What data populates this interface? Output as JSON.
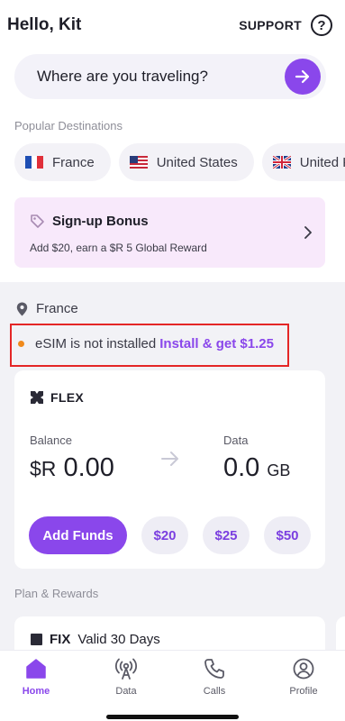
{
  "header": {
    "greeting": "Hello, Kit",
    "support_label": "SUPPORT",
    "help_icon": "?"
  },
  "search": {
    "placeholder": "Where are you traveling?"
  },
  "destinations": {
    "label": "Popular Destinations",
    "items": [
      {
        "name": "France",
        "flag": "france-flag"
      },
      {
        "name": "United States",
        "flag": "us-flag"
      },
      {
        "name": "United K",
        "flag": "uk-flag"
      }
    ]
  },
  "bonus": {
    "title": "Sign-up Bonus",
    "subtitle": "Add $20, earn a $R 5 Global Reward"
  },
  "location": {
    "country": "France"
  },
  "esim": {
    "status": "eSIM is not installed",
    "action": "Install & get $1.25"
  },
  "flex_card": {
    "title": "FLEX",
    "balance_label": "Balance",
    "balance_currency": "$R",
    "balance_value": " 0.00",
    "data_label": "Data",
    "data_value": "0.0 ",
    "data_unit": "GB",
    "add_funds_label": "Add Funds",
    "amounts": [
      "$20",
      "$25",
      "$50"
    ]
  },
  "plans": {
    "label": "Plan & Rewards",
    "first": {
      "badge": "FIX",
      "validity": "Valid 30 Days"
    }
  },
  "nav": {
    "items": [
      {
        "label": "Home",
        "icon": "home-icon",
        "active": true
      },
      {
        "label": "Data",
        "icon": "antenna-icon",
        "active": false
      },
      {
        "label": "Calls",
        "icon": "phone-icon",
        "active": false
      },
      {
        "label": "Profile",
        "icon": "profile-icon",
        "active": false
      }
    ]
  },
  "colors": {
    "accent": "#8a47eb",
    "bonus_bg": "#f8e9fb",
    "status_dot": "#f08a1c",
    "highlight_border": "#e42626"
  }
}
